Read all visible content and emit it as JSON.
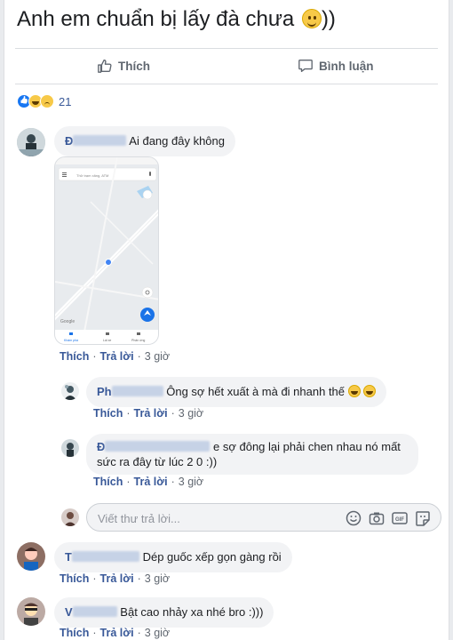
{
  "post": {
    "text": "Anh em chuẩn bị lấy đà chưa",
    "text_suffix": "))"
  },
  "actions": {
    "like_label": "Thích",
    "comment_label": "Bình luận"
  },
  "reactions": {
    "count": "21",
    "types": [
      "like-icon",
      "haha-icon",
      "sad-icon"
    ]
  },
  "comments": [
    {
      "author_initial": "Đ",
      "text": "Ai đang đây không",
      "map": {
        "search_text": "Thử trạm xăng, ATM",
        "google_label": "Google",
        "nav_items": [
          "Khám phá",
          "Lái xe",
          "Phản ứng"
        ]
      },
      "like_label": "Thích",
      "reply_label": "Trả lời",
      "time": "3 giờ"
    },
    {
      "author_initial": "T",
      "text": "Dép guốc xếp gọn gàng rồi",
      "like_label": "Thích",
      "reply_label": "Trả lời",
      "time": "3 giờ"
    },
    {
      "author_initial": "V",
      "text": "Bật cao nhảy xa nhé bro :)))",
      "like_label": "Thích",
      "reply_label": "Trả lời",
      "time": "3 giờ"
    }
  ],
  "replies": [
    {
      "author_initial": "Ph",
      "text": "Ông sợ hết xuất à mà đi nhanh thế",
      "like_label": "Thích",
      "reply_label": "Trả lời",
      "time": "3 giờ"
    },
    {
      "author_initial": "Đ",
      "text": "e sợ đông lại phải chen nhau nó mất",
      "text2": "sức ra đây từ lúc 2 0 :))",
      "like_label": "Thích",
      "reply_label": "Trả lời",
      "time": "3 giờ"
    }
  ],
  "reply_box": {
    "placeholder": "Viết thư trả lời...",
    "icons": [
      "emoji-icon",
      "camera-icon",
      "gif-icon",
      "sticker-icon"
    ]
  },
  "colors": {
    "link": "#385898",
    "bubble": "#f2f3f5",
    "muted": "#606770",
    "like_blue": "#1877f2"
  }
}
